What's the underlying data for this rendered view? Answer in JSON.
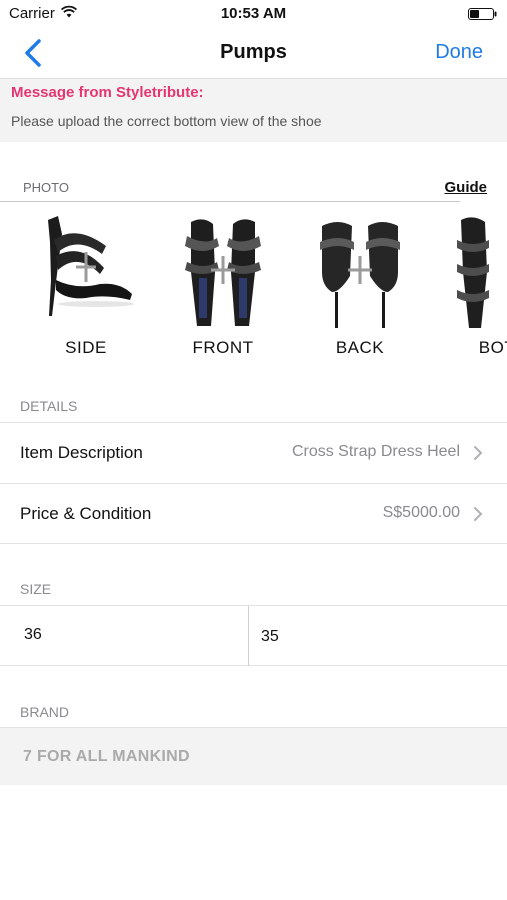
{
  "status_bar": {
    "carrier": "Carrier",
    "time": "10:53 AM"
  },
  "nav": {
    "title": "Pumps",
    "done_label": "Done"
  },
  "message": {
    "title": "Message from Styletribute:",
    "body": "Please upload the correct bottom view of the shoe"
  },
  "photo": {
    "label": "PHOTO",
    "guide_label": "Guide",
    "slots": [
      {
        "label": "SIDE"
      },
      {
        "label": "FRONT"
      },
      {
        "label": "BACK"
      },
      {
        "label": "BOT"
      }
    ]
  },
  "details": {
    "label": "DETAILS",
    "rows": [
      {
        "label": "Item Description",
        "value": "Cross Strap Dress Heel"
      },
      {
        "label": "Price & Condition",
        "value": "S$5000.00"
      }
    ]
  },
  "size": {
    "label": "SIZE",
    "left": "36",
    "right": "35"
  },
  "brand": {
    "label": "BRAND",
    "value": "7 FOR ALL MANKIND"
  },
  "colors": {
    "accent": "#1f7be8",
    "message_title": "#e6366f",
    "muted": "#8a8a8f"
  }
}
